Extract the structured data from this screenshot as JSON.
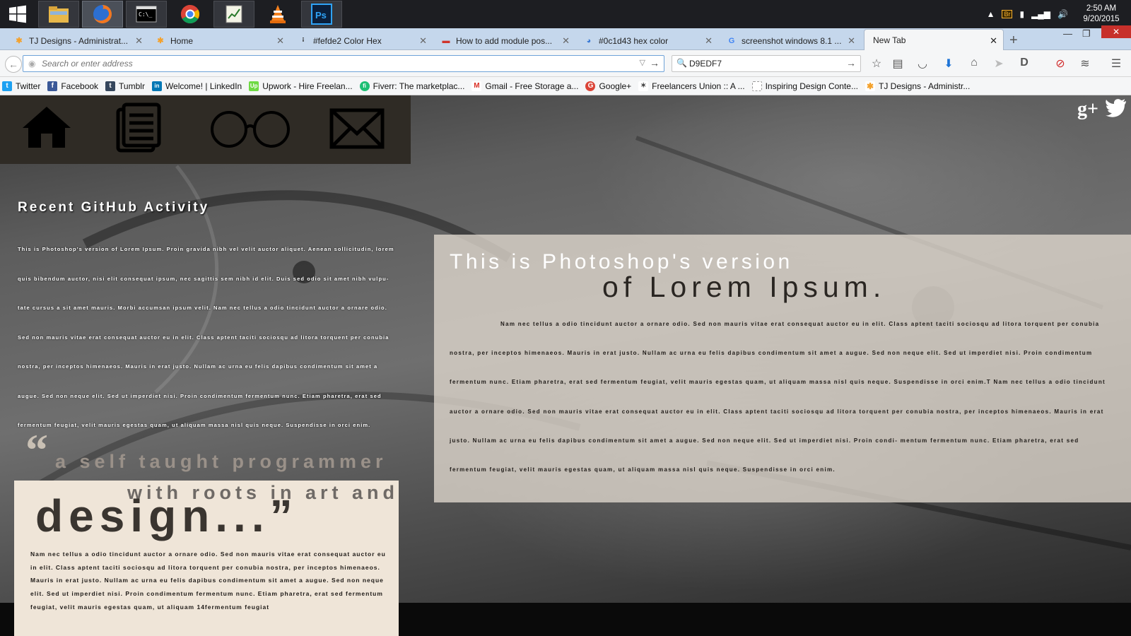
{
  "taskbar": {
    "apps": [
      {
        "name": "start",
        "label": "Start"
      },
      {
        "name": "file-explorer",
        "label": "File Explorer"
      },
      {
        "name": "firefox",
        "label": "Firefox"
      },
      {
        "name": "command-prompt",
        "label": "Command Prompt"
      },
      {
        "name": "chrome",
        "label": "Chrome"
      },
      {
        "name": "notepad",
        "label": "Notepad"
      },
      {
        "name": "vlc",
        "label": "VLC"
      },
      {
        "name": "photoshop",
        "label": "Ps"
      }
    ],
    "clock_time": "2:50 AM",
    "clock_date": "9/20/2015"
  },
  "tabs": [
    {
      "title": "TJ Designs - Administrat...",
      "icon": "joomla-icon",
      "color": "#f4a12b"
    },
    {
      "title": "Home",
      "icon": "joomla-icon",
      "color": "#f4a12b"
    },
    {
      "title": "#fefde2 Color Hex",
      "icon": "pin-icon",
      "color": "#333333"
    },
    {
      "title": "How to add module pos...",
      "icon": "stack-icon",
      "color": "#d0342c"
    },
    {
      "title": "#0c1d43 hex color",
      "icon": "color-wheel-icon",
      "color": "#3b7bd6"
    },
    {
      "title": "screenshot windows 8.1 ...",
      "icon": "google-icon",
      "color": "#4285f4"
    },
    {
      "title": "New Tab",
      "icon": "",
      "color": "#000000"
    }
  ],
  "navbar": {
    "url_placeholder": "Search or enter address",
    "search_value": "D9EDF7"
  },
  "bookmarks": [
    {
      "label": "Twitter",
      "icon": "twitter-icon",
      "color": "#1da1f2",
      "glyph": "t"
    },
    {
      "label": "Facebook",
      "icon": "facebook-icon",
      "color": "#3b5998",
      "glyph": "f"
    },
    {
      "label": "Tumblr",
      "icon": "tumblr-icon",
      "color": "#35465c",
      "glyph": "t"
    },
    {
      "label": "Welcome! | LinkedIn",
      "icon": "linkedin-icon",
      "color": "#0077b5",
      "glyph": "in"
    },
    {
      "label": "Upwork - Hire Freelan...",
      "icon": "upwork-icon",
      "color": "#6fda44",
      "glyph": "Up"
    },
    {
      "label": "Fiverr: The marketplac...",
      "icon": "fiverr-icon",
      "color": "#1dbf73",
      "glyph": "fi"
    },
    {
      "label": "Gmail - Free Storage a...",
      "icon": "gmail-icon",
      "color": "#d93025",
      "glyph": "M"
    },
    {
      "label": "Google+",
      "icon": "google-plus-icon",
      "color": "#db4437",
      "glyph": "G"
    },
    {
      "label": "Freelancers Union :: A ...",
      "icon": "freelancers-union-icon",
      "color": "#444444",
      "glyph": "✶"
    },
    {
      "label": "Inspiring Design Conte...",
      "icon": "blank-page-icon",
      "color": "#ffffff",
      "glyph": ""
    },
    {
      "label": "TJ Designs - Administr...",
      "icon": "joomla-icon",
      "color": "#f4a12b",
      "glyph": "✱"
    }
  ],
  "page": {
    "nav_icons": [
      "home-icon",
      "documents-icon",
      "glasses-icon",
      "mail-icon"
    ],
    "social_icons": [
      "google-plus-icon",
      "twitter-icon"
    ],
    "github": {
      "title": "Recent GitHub Activity",
      "body": "This is Photoshop's version  of Lorem Ipsum. Proin gravida nibh vel velit auctor aliquet. Aenean sollicitudin, lorem quis bibendum auctor, nisi elit consequat ipsum, nec sagittis sem nibh id elit. Duis sed odio sit amet nibh vulpu- tate cursus a sit amet mauris. Morbi accumsan ipsum velit. Nam nec tellus a odio tincidunt auctor a ornare odio. Sed non  mauris vitae erat consequat auctor eu in elit. Class aptent taciti sociosqu ad litora torquent per conubia nostra, per inceptos himenaeos. Mauris in erat justo. Nullam ac urna eu felis dapibus condimentum sit amet a augue. Sed non neque elit. Sed ut imperdiet nisi. Proin condimentum fermentum nunc. Etiam pharetra, erat sed fermentum feugiat, velit mauris egestas quam, ut aliquam massa nisl quis neque. Suspendisse in orci enim."
    },
    "quote": {
      "mark": "“",
      "line1": "a self taught programmer",
      "line2": "with roots in art and",
      "line3": "design...”",
      "body": "Nam nec tellus a odio tincidunt auctor a ornare odio. Sed non  mauris vitae erat consequat auctor eu in elit. Class aptent taciti sociosqu ad litora torquent per conubia nostra, per inceptos himenaeos. Mauris in erat justo. Nullam ac urna eu felis dapibus condimentum sit amet a augue. Sed non neque elit. Sed ut imperdiet nisi. Proin condimentum fermentum nunc. Etiam pharetra, erat sed fermentum feugiat, velit mauris egestas quam, ut aliquam 14fermentum feugiat"
    },
    "lorem": {
      "heading1": "This is Photoshop's version",
      "heading2": "of Lorem Ipsum.",
      "body": "Nam nec tellus a odio tincidunt auctor a ornare odio. Sed non  mauris vitae erat consequat auctor eu in elit. Class aptent taciti sociosqu ad litora torquent per conubia nostra, per inceptos himenaeos. Mauris in erat justo. Nullam ac urna eu felis dapibus condimentum sit amet a augue. Sed non neque elit. Sed ut imperdiet nisi. Proin condimentum fermentum nunc. Etiam pharetra, erat sed fermentum feugiat, velit mauris egestas quam, ut aliquam massa nisl quis neque. Suspendisse in orci enim.T Nam nec tellus a odio tincidunt auctor a ornare odio. Sed non  mauris vitae erat consequat auctor eu in elit. Class aptent taciti sociosqu ad litora torquent per conubia nostra, per inceptos himenaeos. Mauris in erat justo. Nullam ac urna eu felis dapibus condimentum sit amet a augue. Sed non neque elit. Sed ut imperdiet nisi. Proin condi- mentum fermentum nunc. Etiam pharetra, erat sed fermentum feugiat, velit mauris egestas quam, ut aliquam massa nisl quis neque. Suspendisse in orci enim."
    }
  }
}
